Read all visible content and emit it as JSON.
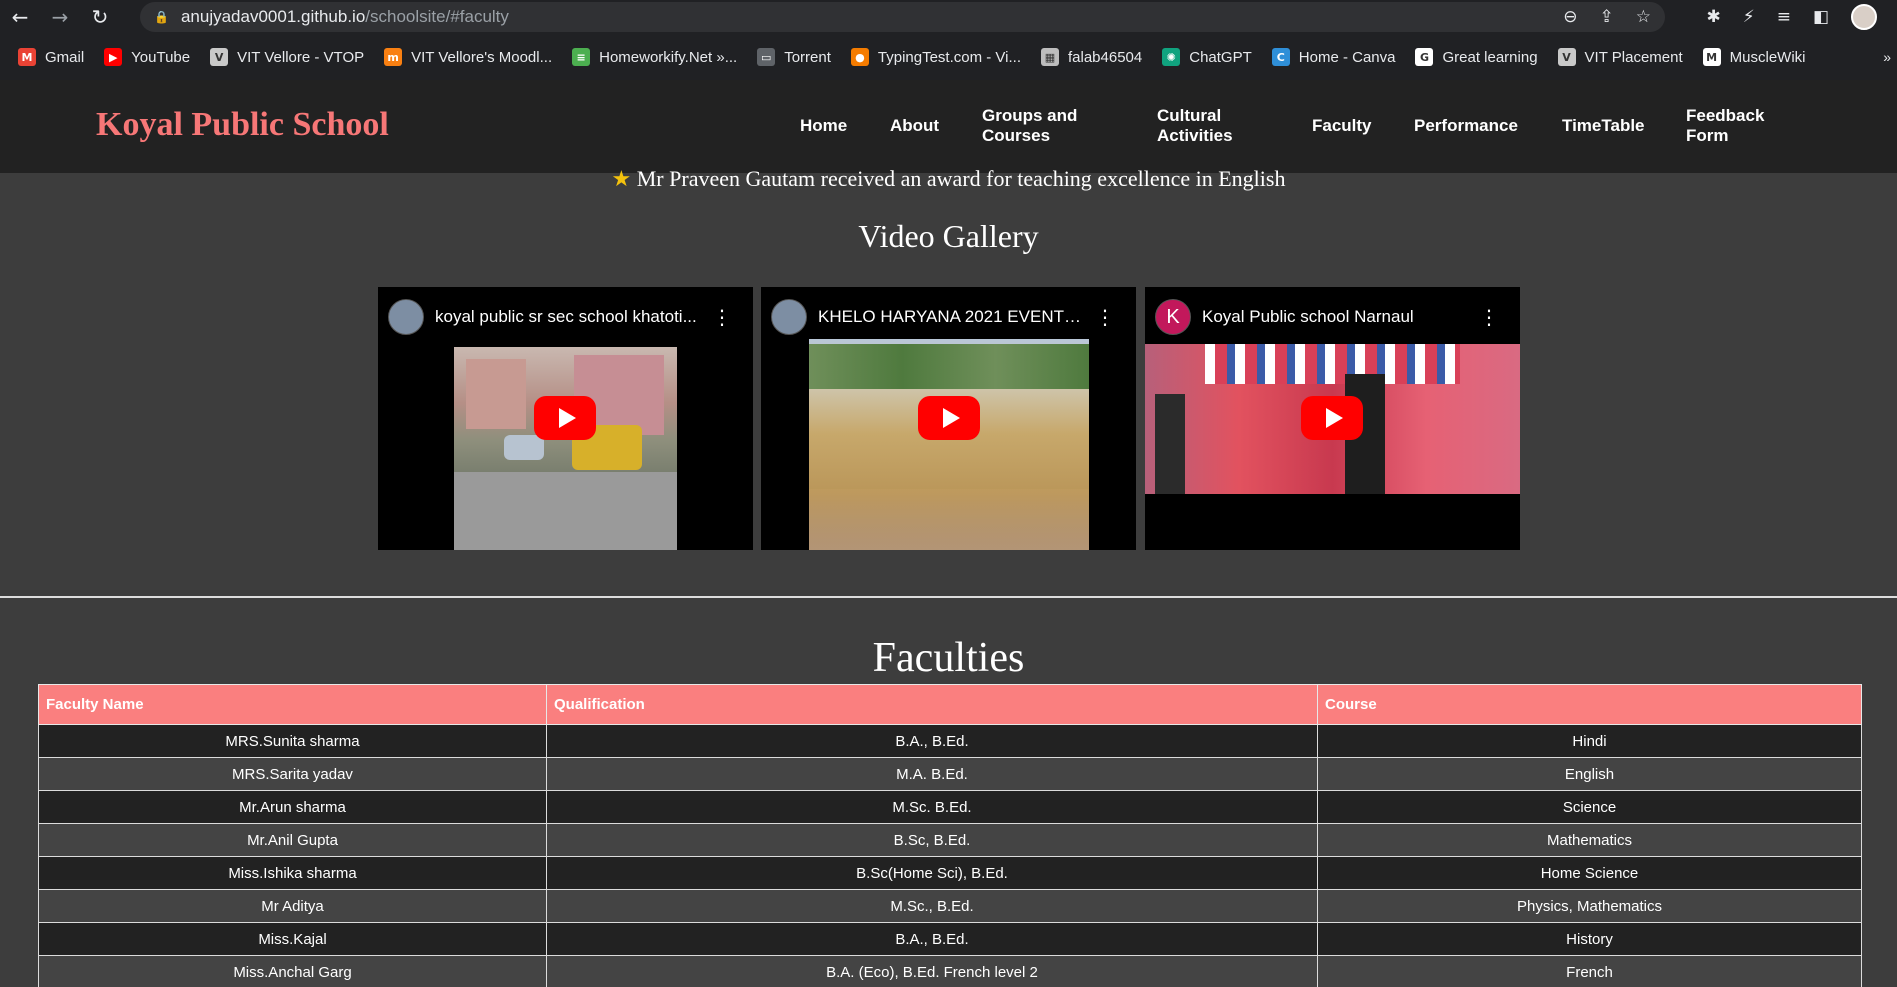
{
  "browser": {
    "url_host": "anujyadav0001.github.io",
    "url_path": "/schoolsite/#faculty",
    "bookmarks": [
      {
        "label": "Gmail",
        "icon": "gmail-icon",
        "color": "#ea4335",
        "glyph": "M"
      },
      {
        "label": "YouTube",
        "icon": "youtube-icon",
        "color": "#ff0000",
        "glyph": "▶"
      },
      {
        "label": "VIT Vellore - VTOP",
        "icon": "vtop-icon",
        "color": "#c9c9c9",
        "glyph": "V"
      },
      {
        "label": "VIT Vellore's Moodl...",
        "icon": "moodle-icon",
        "color": "#f98012",
        "glyph": "m"
      },
      {
        "label": "Homeworkify.Net »...",
        "icon": "homeworkify-icon",
        "color": "#4caf50",
        "glyph": "≡"
      },
      {
        "label": "Torrent",
        "icon": "torrent-icon",
        "color": "#5f6368",
        "glyph": "▭"
      },
      {
        "label": "TypingTest.com - Vi...",
        "icon": "typingtest-icon",
        "color": "#f57c00",
        "glyph": "●"
      },
      {
        "label": "falab46504",
        "icon": "falab-icon",
        "color": "#bdbdbd",
        "glyph": "▦"
      },
      {
        "label": "ChatGPT",
        "icon": "chatgpt-icon",
        "color": "#10a37f",
        "glyph": "✺"
      },
      {
        "label": "Home - Canva",
        "icon": "canva-icon",
        "color": "#2f8fd8",
        "glyph": "C"
      },
      {
        "label": "Great learning",
        "icon": "great-learning-icon",
        "color": "#ffffff",
        "glyph": "G"
      },
      {
        "label": "VIT Placement",
        "icon": "vit-placement-icon",
        "color": "#c9c9c9",
        "glyph": "V"
      },
      {
        "label": "MuscleWiki",
        "icon": "musclewiki-icon",
        "color": "#ffffff",
        "glyph": "M"
      }
    ]
  },
  "site": {
    "title": "Koyal Public School",
    "nav": {
      "home": "Home",
      "about": "About",
      "groups_line1": "Groups and",
      "groups_line2": "Courses",
      "cultural_line1": "Cultural",
      "cultural_line2": "Activities",
      "faculty": "Faculty",
      "performance": "Performance",
      "timetable": "TimeTable",
      "feedback_line1": "Feedback",
      "feedback_line2": "Form"
    }
  },
  "award_text": "Mr Praveen Gautam received an award for teaching excellence in English",
  "video_gallery": {
    "heading": "Video Gallery",
    "videos": [
      {
        "title": "koyal public sr sec school khatoti...",
        "avatar_letter": ""
      },
      {
        "title": "KHELO HARYANA 2021 EVENTS....",
        "avatar_letter": ""
      },
      {
        "title": "Koyal Public school Narnaul",
        "avatar_letter": "K"
      }
    ]
  },
  "faculties": {
    "heading": "Faculties",
    "columns": [
      "Faculty Name",
      "Qualification",
      "Course"
    ],
    "rows": [
      [
        "MRS.Sunita sharma",
        "B.A., B.Ed.",
        "Hindi"
      ],
      [
        "MRS.Sarita yadav",
        "M.A. B.Ed.",
        "English"
      ],
      [
        "Mr.Arun sharma",
        "M.Sc. B.Ed.",
        "Science"
      ],
      [
        "Mr.Anil Gupta",
        "B.Sc, B.Ed.",
        "Mathematics"
      ],
      [
        "Miss.Ishika sharma",
        "B.Sc(Home Sci), B.Ed.",
        "Home Science"
      ],
      [
        "Mr Aditya",
        "M.Sc., B.Ed.",
        "Physics, Mathematics"
      ],
      [
        "Miss.Kajal",
        "B.A., B.Ed.",
        "History"
      ],
      [
        "Miss.Anchal Garg",
        "B.A. (Eco), B.Ed. French level 2",
        "French"
      ]
    ]
  },
  "colors": {
    "accent": "#f77777",
    "table_header": "#fa7f7f",
    "page_bg": "#3d3d3d",
    "header_bg": "#222222"
  }
}
